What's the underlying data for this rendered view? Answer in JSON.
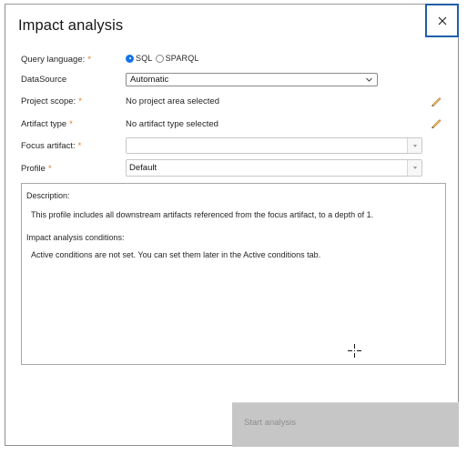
{
  "dialog": {
    "title": "Impact analysis",
    "close_icon": "close-icon"
  },
  "form": {
    "query_language": {
      "label": "Query language:",
      "required": "*",
      "options": [
        {
          "label": "SQL",
          "selected": true
        },
        {
          "label": "SPARQL",
          "selected": false
        }
      ]
    },
    "datasource": {
      "label": "DataSource",
      "value": "Automatic"
    },
    "project_scope": {
      "label": "Project scope:",
      "required": "*",
      "value": "No project area selected",
      "edit_icon": "pencil-icon"
    },
    "artifact_type": {
      "label": "Artifact type",
      "required": "*",
      "value": "No artifact type selected",
      "edit_icon": "pencil-icon"
    },
    "focus_artifact": {
      "label": "Focus artifact:",
      "required": "*",
      "value": ""
    },
    "profile": {
      "label": "Profile",
      "required": "*",
      "value": "Default"
    }
  },
  "description": {
    "heading": "Description:",
    "text": "This profile includes all downstream artifacts referenced from the focus artifact, to a depth of 1.",
    "conditions_heading": "Impact analysis conditions:",
    "conditions_text": "Active conditions are not set. You can set them later in the Active conditions tab."
  },
  "footer": {
    "start_label": "Start analysis",
    "start_enabled": false
  },
  "colors": {
    "accent": "#1473e6",
    "required": "#e07a1f",
    "close_border": "#1f5fa8",
    "disabled_button_bg": "#c6c6c6",
    "disabled_button_text": "#8d8d8d"
  }
}
